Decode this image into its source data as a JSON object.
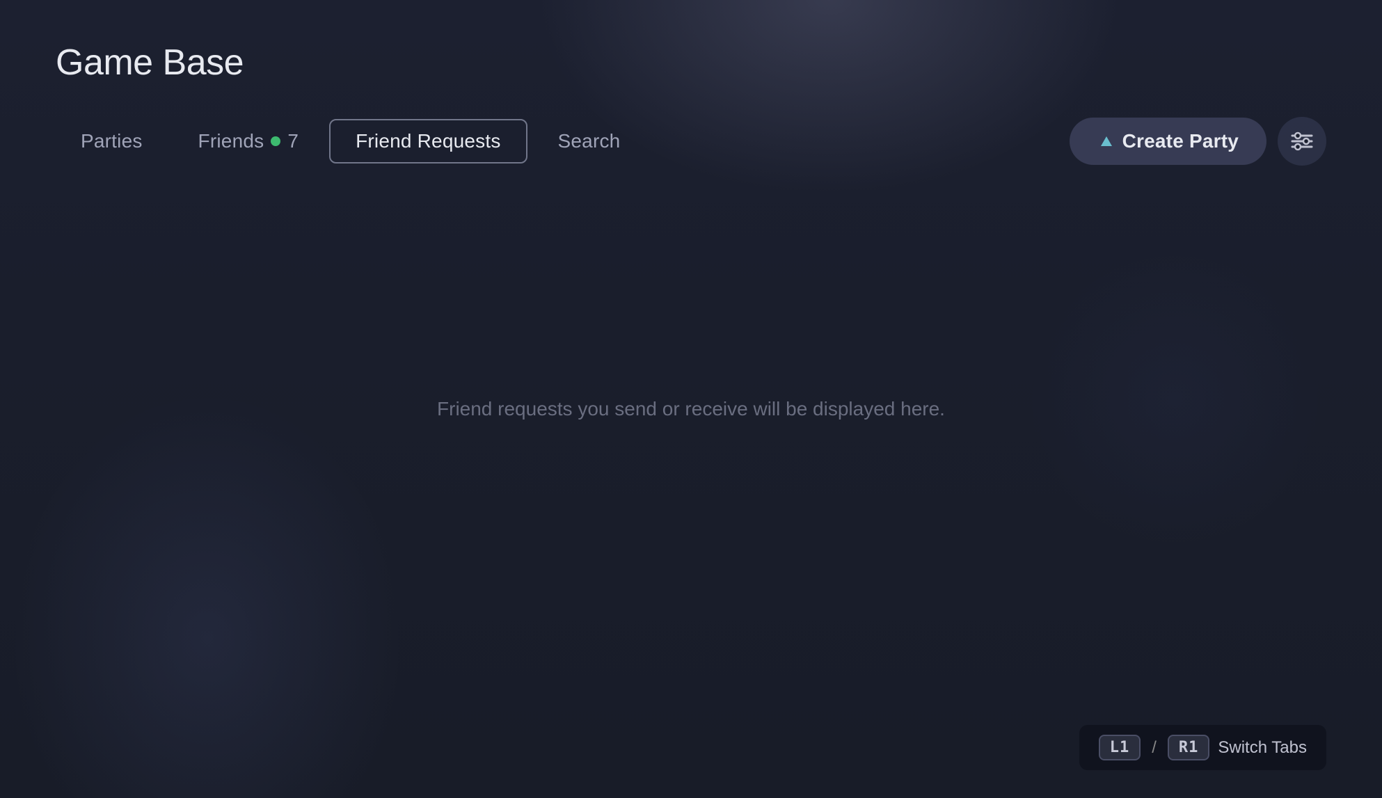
{
  "page": {
    "title": "Game Base",
    "background_color": "#1a1f2e"
  },
  "tabs": [
    {
      "id": "parties",
      "label": "Parties",
      "active": false,
      "notification": null
    },
    {
      "id": "friends",
      "label": "Friends",
      "active": false,
      "notification": {
        "dot": true,
        "count": "7"
      }
    },
    {
      "id": "friend-requests",
      "label": "Friend Requests",
      "active": true,
      "notification": null
    },
    {
      "id": "search",
      "label": "Search",
      "active": false,
      "notification": null
    }
  ],
  "actions": {
    "create_party_label": "Create Party",
    "filter_button_title": "Filter"
  },
  "main": {
    "empty_message": "Friend requests you send or receive will be displayed here."
  },
  "bottom": {
    "hint_l1": "L1",
    "hint_separator": "/",
    "hint_r1": "R1",
    "hint_label": "Switch Tabs"
  }
}
